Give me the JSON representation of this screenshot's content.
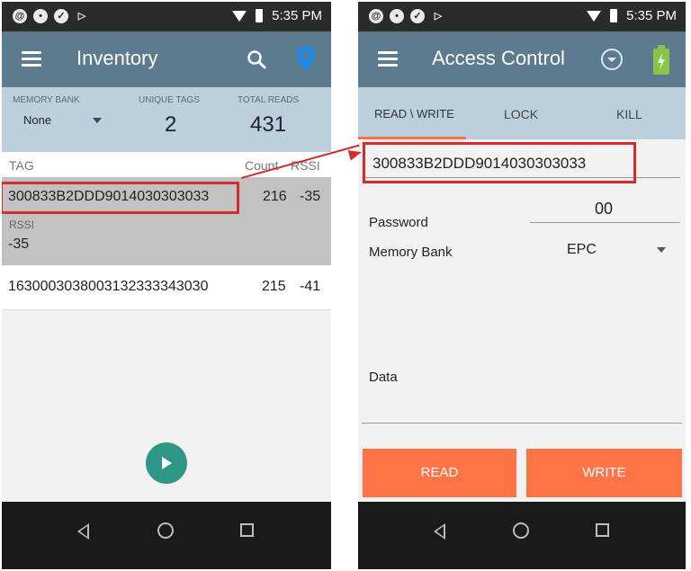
{
  "status_bar": {
    "time": "5:35 PM"
  },
  "inventory": {
    "title": "Inventory",
    "memory_bank_label": "MEMORY BANK",
    "memory_bank_value": "None",
    "unique_tags_label": "UNIQUE TAGS",
    "unique_tags_value": "2",
    "total_reads_label": "TOTAL READS",
    "total_reads_value": "431",
    "columns": {
      "tag": "TAG",
      "count": "Count",
      "rssi": "RSSI"
    },
    "rows": [
      {
        "tag": "300833B2DDD9014030303033",
        "count": "216",
        "rssi": "-35",
        "detail_label": "RSSI",
        "detail_value": "-35"
      },
      {
        "tag": "1630003038003132333343030",
        "count": "215",
        "rssi": "-41"
      }
    ]
  },
  "access_control": {
    "title": "Access Control",
    "tabs": [
      "READ \\ WRITE",
      "LOCK",
      "KILL"
    ],
    "tag_id": "300833B2DDD9014030303033",
    "password_label": "Password",
    "password_value": "00",
    "memory_bank_label": "Memory Bank",
    "memory_bank_value": "EPC",
    "data_label": "Data",
    "read_button": "READ",
    "write_button": "WRITE"
  },
  "colors": {
    "accent": "#ff7447",
    "appbar": "#5d7b8f",
    "highlight": "#d42b2b"
  }
}
